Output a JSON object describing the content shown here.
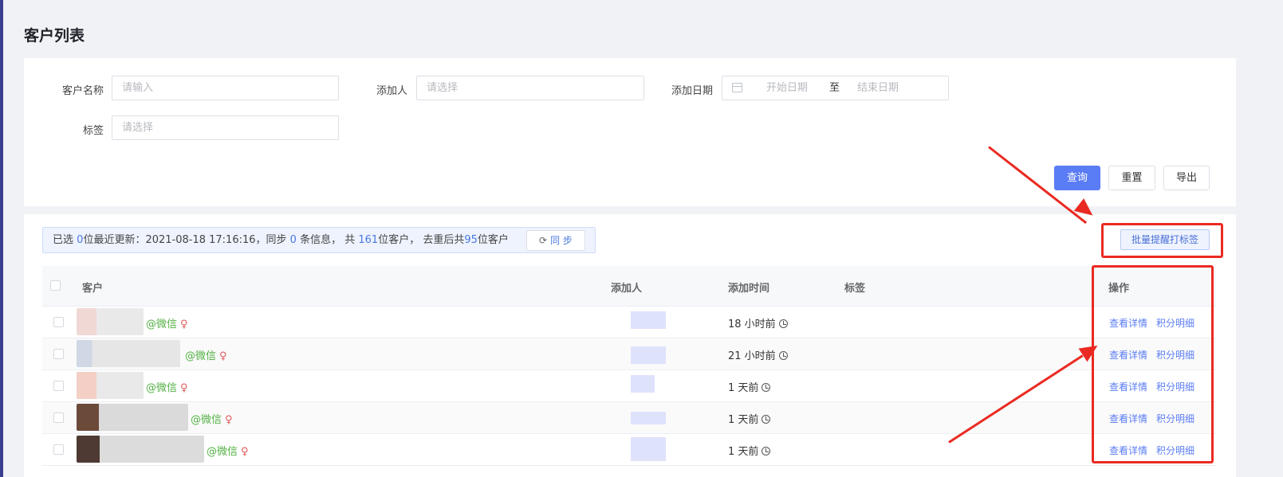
{
  "page": {
    "title": "客户列表"
  },
  "filters": {
    "customer_name_label": "客户名称",
    "customer_name_placeholder": "请输入",
    "adder_label": "添加人",
    "adder_placeholder": "请选择",
    "date_label": "添加日期",
    "date_start_placeholder": "开始日期",
    "date_separator": "至",
    "date_end_placeholder": "结束日期",
    "tag_label": "标签",
    "tag_placeholder": "请选择"
  },
  "actions": {
    "query": "查询",
    "reset": "重置",
    "export": "导出",
    "batch_tag": "批量提醒打标签"
  },
  "sync": {
    "prefix": "已选",
    "selected": "0",
    "text1": "位最近更新：2021-08-18 17:16:16，同步",
    "synced": "0",
    "text2": "条信息，  共",
    "total": "161",
    "text3": "位客户，  去重后共",
    "dedup": "95",
    "text4": "位客户",
    "button": "同 步"
  },
  "table": {
    "headers": {
      "customer": "客户",
      "adder": "添加人",
      "added_time": "添加时间",
      "tags": "标签",
      "operation": "操作"
    },
    "rows": [
      {
        "source": "@微信",
        "gender_icon": "♀",
        "time": "18 小时前",
        "detail": "查看详情",
        "points": "积分明细"
      },
      {
        "source": "@微信",
        "gender_icon": "♀",
        "time": "21 小时前",
        "detail": "查看详情",
        "points": "积分明细"
      },
      {
        "source": "@微信",
        "gender_icon": "♀",
        "time": "1 天前",
        "detail": "查看详情",
        "points": "积分明细"
      },
      {
        "source": "@微信",
        "gender_icon": "♀",
        "time": "1 天前",
        "detail": "查看详情",
        "points": "积分明细"
      },
      {
        "source": "@微信",
        "gender_icon": "♀",
        "time": "1 天前",
        "detail": "查看详情",
        "points": "积分明细"
      }
    ]
  },
  "colors": {
    "primary": "#5a7cf5",
    "wechat": "#52b043",
    "annotation": "#ea2a22"
  }
}
